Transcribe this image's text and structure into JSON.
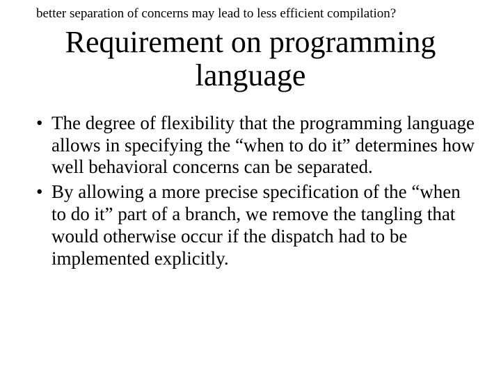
{
  "note": "better separation of concerns may lead to less efficient compilation?",
  "title": "Requirement on programming language",
  "bullets": [
    "The degree of flexibility that the programming language allows in specifying the “when to do it” determines how well behavioral concerns can be separated.",
    "By allowing a more precise specification of the “when to do it” part of a branch, we remove the tangling that would otherwise occur if the dispatch had to be implemented explicitly."
  ]
}
